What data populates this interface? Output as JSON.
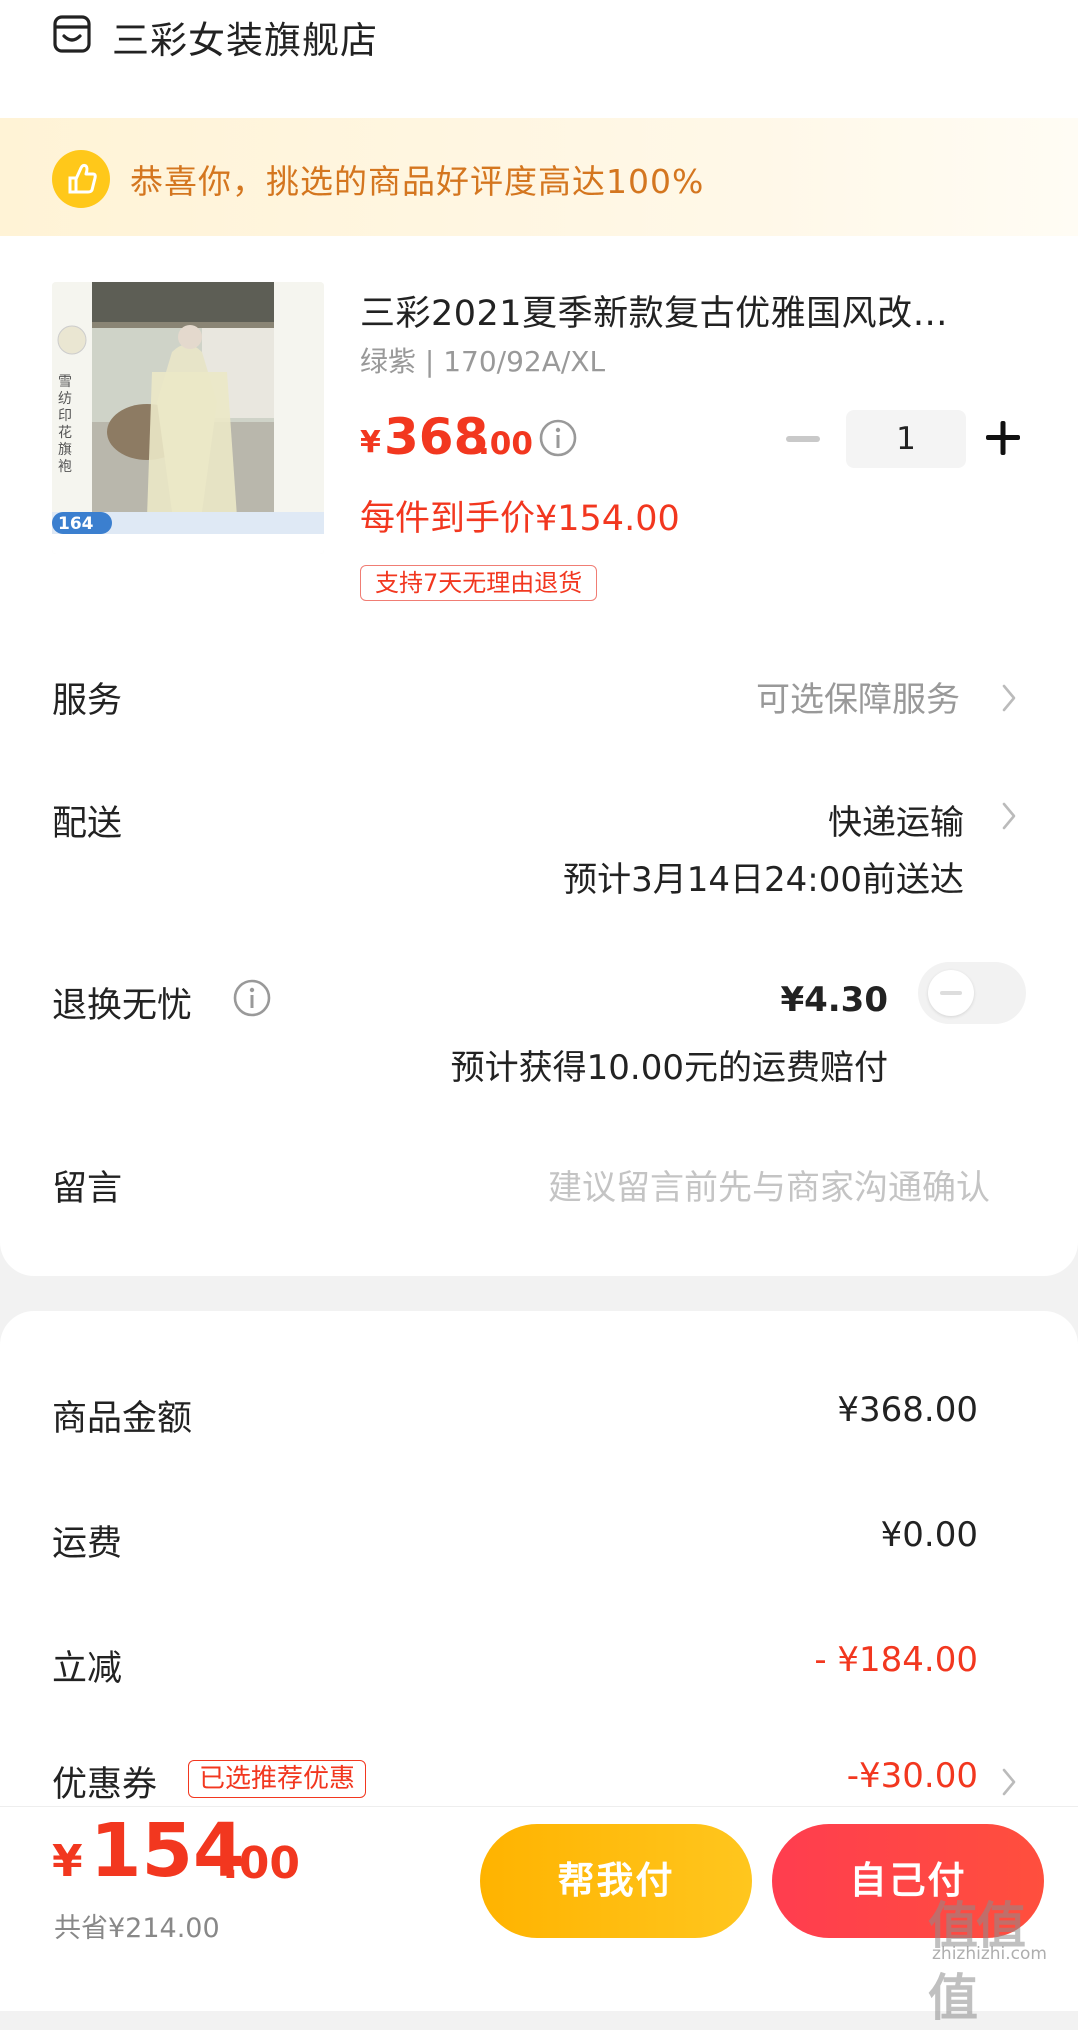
{
  "store": {
    "name": "三彩女装旗舰店",
    "icon": "store-icon"
  },
  "banner": {
    "text": "恭喜你，挑选的商品好评度高达100%",
    "icon": "thumbs-up-icon"
  },
  "product": {
    "image_alt": "雪纺印花旗袍",
    "image_label": "雪纺印花旗袍",
    "image_price": "164",
    "title": "三彩2021夏季新款复古优雅国风改…",
    "spec": "绿紫 | 170/92A/XL",
    "price_symbol": "¥",
    "price_int": "368",
    "price_dec": ".00",
    "unit_price": "每件到手价¥154.00",
    "return_badge": "支持7天无理由退货",
    "quantity": "1"
  },
  "rows": {
    "service_label": "服务",
    "service_value": "可选保障服务",
    "delivery_label": "配送",
    "delivery_value": "快递运输",
    "delivery_eta": "预计3月14日24:00前送达",
    "insurance_label": "退换无忧",
    "insurance_price": "¥4.30",
    "insurance_note": "预计获得10.00元的运费赔付",
    "message_label": "留言",
    "message_placeholder": "建议留言前先与商家沟通确认"
  },
  "summary": {
    "goods_label": "商品金额",
    "goods_value": "¥368.00",
    "shipping_label": "运费",
    "shipping_value": "¥0.00",
    "discount_label": "立减",
    "discount_value": "- ¥184.00",
    "coupon_label": "优惠券",
    "coupon_badge": "已选推荐优惠",
    "coupon_value": "-¥30.00"
  },
  "footer": {
    "total_symbol": "¥",
    "total_int": "154",
    "total_dec": ".00",
    "saved": "共省¥214.00",
    "help_pay": "帮我付",
    "self_pay": "自己付"
  },
  "watermark": {
    "text": "值值值",
    "url": "zhizhizhi.com"
  },
  "colors": {
    "accent_red": "#f2371f",
    "banner_text": "#d4761f",
    "help_btn": "#ffb300",
    "self_btn": "#ff3d4f"
  }
}
